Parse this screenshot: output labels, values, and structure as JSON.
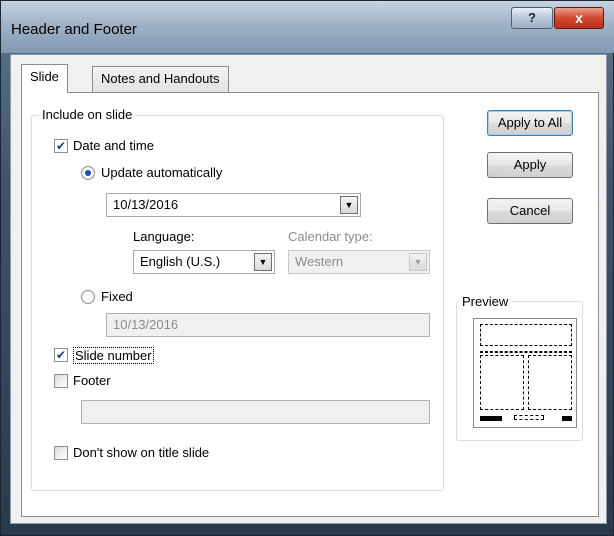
{
  "window": {
    "title": "Header and Footer",
    "help_label": "?",
    "close_label": "x"
  },
  "tabs": [
    {
      "label": "Slide"
    },
    {
      "label": "Notes and Handouts"
    }
  ],
  "include_group": {
    "label": "Include on slide"
  },
  "date_time": {
    "label": "Date and time",
    "checked": true,
    "update_auto": {
      "label": "Update automatically",
      "selected": true,
      "value": "10/13/2016"
    },
    "language": {
      "label": "Language:",
      "value": "English (U.S.)"
    },
    "calendar": {
      "label": "Calendar type:",
      "value": "Western"
    },
    "fixed": {
      "label": "Fixed",
      "selected": false,
      "value": "10/13/2016"
    }
  },
  "slide_number": {
    "label": "Slide number",
    "checked": true
  },
  "footer": {
    "label": "Footer",
    "checked": false,
    "value": ""
  },
  "dont_show": {
    "label": "Don't show on title slide",
    "checked": false
  },
  "buttons": {
    "apply_all": "Apply to All",
    "apply": "Apply",
    "cancel": "Cancel"
  },
  "preview": {
    "label": "Preview"
  }
}
